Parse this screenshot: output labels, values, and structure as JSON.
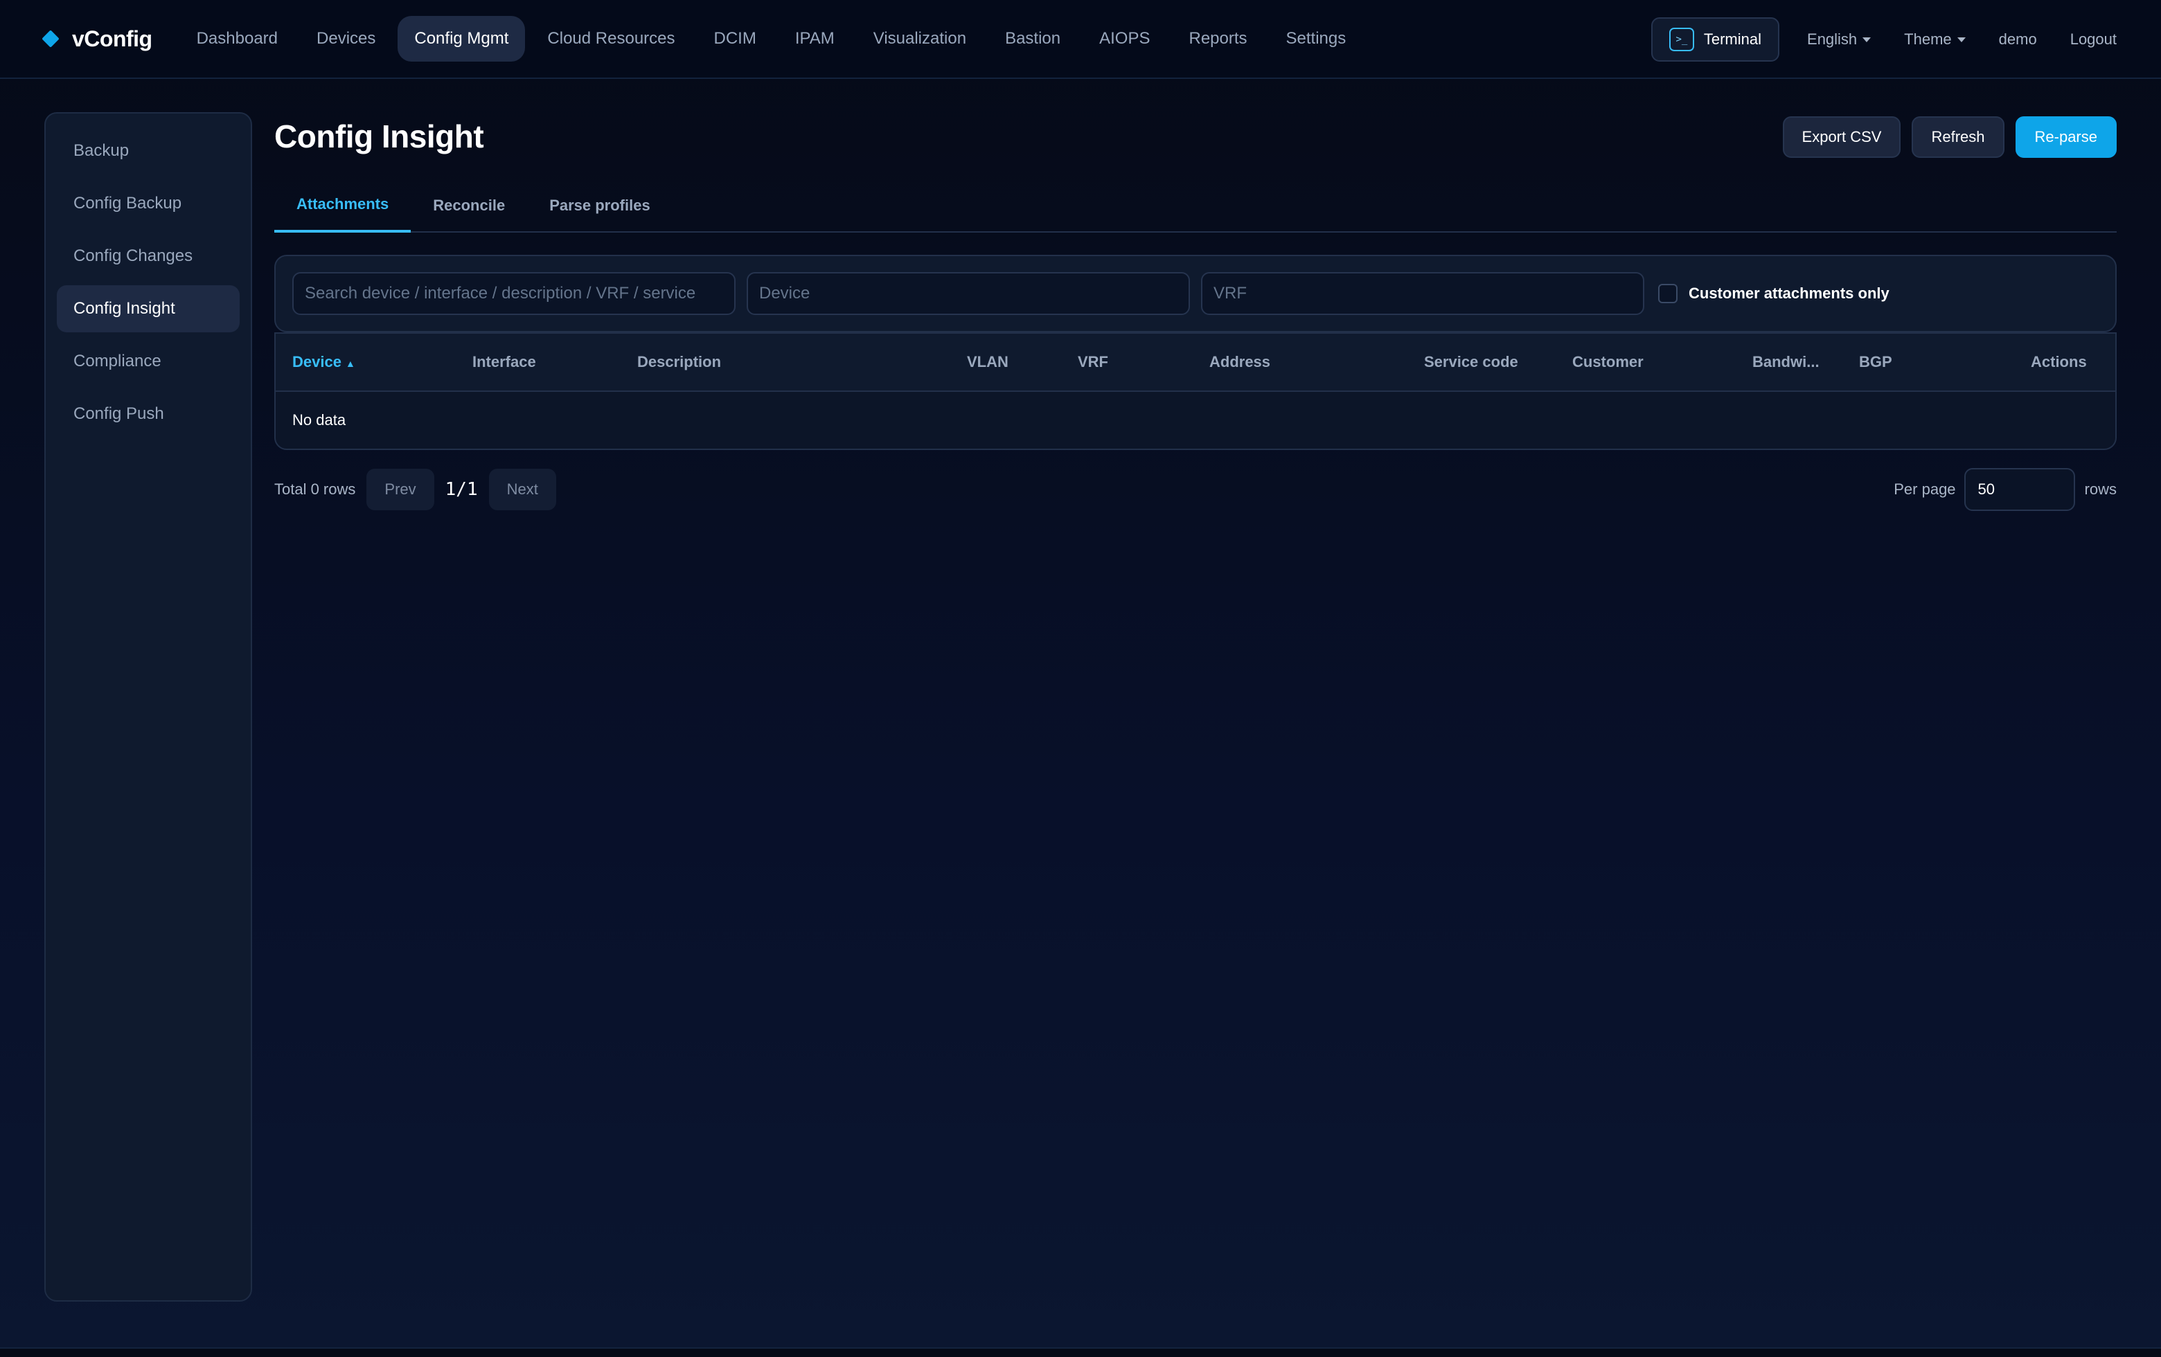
{
  "app": {
    "name": "vConfig"
  },
  "nav": {
    "items": [
      {
        "label": "Dashboard"
      },
      {
        "label": "Devices"
      },
      {
        "label": "Config Mgmt",
        "active": true
      },
      {
        "label": "Cloud Resources"
      },
      {
        "label": "DCIM"
      },
      {
        "label": "IPAM"
      },
      {
        "label": "Visualization"
      },
      {
        "label": "Bastion"
      },
      {
        "label": "AIOPS"
      },
      {
        "label": "Reports"
      },
      {
        "label": "Settings"
      }
    ],
    "terminal_label": "Terminal",
    "language_label": "English",
    "theme_label": "Theme",
    "user_label": "demo",
    "logout_label": "Logout"
  },
  "sidebar": {
    "items": [
      {
        "label": "Backup"
      },
      {
        "label": "Config Backup"
      },
      {
        "label": "Config Changes"
      },
      {
        "label": "Config Insight",
        "active": true
      },
      {
        "label": "Compliance"
      },
      {
        "label": "Config Push"
      }
    ]
  },
  "page": {
    "title": "Config Insight",
    "actions": {
      "export_label": "Export CSV",
      "refresh_label": "Refresh",
      "reparse_label": "Re-parse"
    },
    "tabs": [
      {
        "label": "Attachments",
        "active": true
      },
      {
        "label": "Reconcile"
      },
      {
        "label": "Parse profiles"
      }
    ]
  },
  "filters": {
    "search_placeholder": "Search device / interface / description / VRF / service",
    "device_placeholder": "Device",
    "vrf_placeholder": "VRF",
    "customer_only_label": "Customer attachments only",
    "customer_only_checked": false
  },
  "table": {
    "columns": [
      "Device",
      "Interface",
      "Description",
      "VLAN",
      "VRF",
      "Address",
      "Service code",
      "Customer",
      "Bandwi...",
      "BGP",
      "Actions"
    ],
    "sort_arrow": "▲",
    "empty_text": "No data",
    "rows": []
  },
  "pagination": {
    "total_text": "Total 0 rows",
    "prev_label": "Prev",
    "page_info": "1/1",
    "next_label": "Next",
    "per_page_label": "Per page",
    "per_page_value": "50",
    "rows_label": "rows"
  },
  "colors": {
    "accent": "#0ea5e9",
    "background": "#050a17",
    "panel": "#0f1a2e"
  }
}
